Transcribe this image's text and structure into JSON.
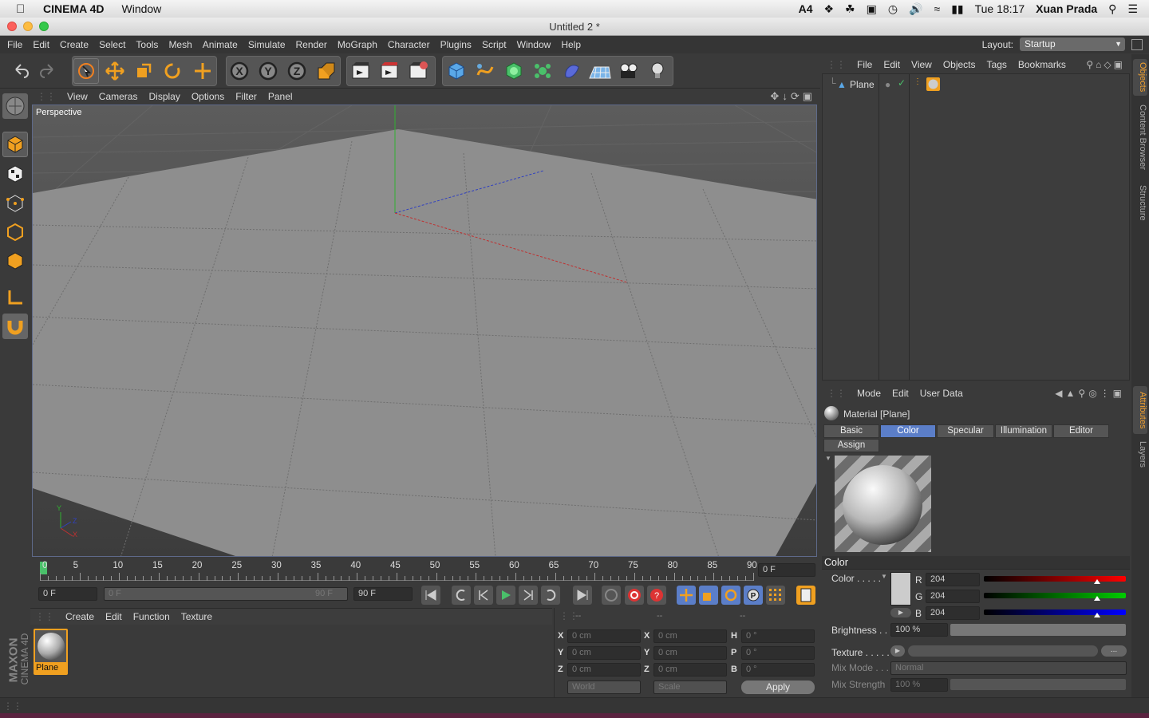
{
  "mac_menubar": {
    "app_name": "CINEMA 4D",
    "menu": "Window",
    "status_a": "4",
    "clock": "Tue 18:17",
    "user": "Xuan Prada"
  },
  "window": {
    "title": "Untitled 2 *"
  },
  "app_menu": {
    "items": [
      "File",
      "Edit",
      "Create",
      "Select",
      "Tools",
      "Mesh",
      "Animate",
      "Simulate",
      "Render",
      "MoGraph",
      "Character",
      "Plugins",
      "Script",
      "Window",
      "Help"
    ],
    "layout_label": "Layout:",
    "layout_value": "Startup"
  },
  "viewport": {
    "menu": [
      "View",
      "Cameras",
      "Display",
      "Options",
      "Filter",
      "Panel"
    ],
    "camera_label": "Perspective",
    "axis_y": "Y",
    "axis_z": "Z",
    "axis_x": "X"
  },
  "timeline": {
    "ticks": [
      "0",
      "5",
      "10",
      "15",
      "20",
      "25",
      "30",
      "35",
      "40",
      "45",
      "50",
      "55",
      "60",
      "65",
      "70",
      "75",
      "80",
      "85",
      "90"
    ],
    "current_frame": "0 F",
    "start_field": "0 F",
    "range_start": "0 F",
    "range_end": "90 F",
    "end_field": "90 F"
  },
  "material_manager": {
    "menu": [
      "Create",
      "Edit",
      "Function",
      "Texture"
    ],
    "material_name": "Plane"
  },
  "coordinates": {
    "headers": [
      "--",
      "--",
      "--"
    ],
    "rows": [
      {
        "l1": "X",
        "v1": "0 cm",
        "l2": "X",
        "v2": "0 cm",
        "l3": "H",
        "v3": "0 °"
      },
      {
        "l1": "Y",
        "v1": "0 cm",
        "l2": "Y",
        "v2": "0 cm",
        "l3": "P",
        "v3": "0 °"
      },
      {
        "l1": "Z",
        "v1": "0 cm",
        "l2": "Z",
        "v2": "0 cm",
        "l3": "B",
        "v3": "0 °"
      }
    ],
    "world": "World",
    "scale": "Scale",
    "apply": "Apply"
  },
  "object_manager": {
    "menu": [
      "File",
      "Edit",
      "View",
      "Objects",
      "Tags",
      "Bookmarks"
    ],
    "object_name": "Plane"
  },
  "attributes": {
    "menu": [
      "Mode",
      "Edit",
      "User Data"
    ],
    "title": "Material [Plane]",
    "tabs": [
      "Basic",
      "Color",
      "Specular",
      "Illumination",
      "Editor"
    ],
    "tab2": "Assign",
    "section": "Color",
    "color_label": "Color . . . . .",
    "r_label": "R",
    "r_value": "204",
    "g_label": "G",
    "g_value": "204",
    "b_label": "B",
    "b_value": "204",
    "brightness_label": "Brightness . .",
    "brightness_value": "100 %",
    "texture_label": "Texture . . . . .",
    "texture_more": "...",
    "mixmode_label": "Mix Mode . . .",
    "mixmode_value": "Normal",
    "mixstrength_label": "Mix Strength",
    "mixstrength_value": "100 %",
    "rgb_level": 0.8
  },
  "side_tabs": [
    "Objects",
    "Content Browser",
    "Structure",
    "Attributes",
    "Layers"
  ],
  "brand": {
    "maxon": "MAXON",
    "c4d": "CINEMA 4D"
  },
  "colors": {
    "accent": "#5b7ec8",
    "material_highlight": "#f0a020",
    "x_axis": "#c03030",
    "y_axis": "#30b030",
    "z_axis": "#3040c0"
  }
}
